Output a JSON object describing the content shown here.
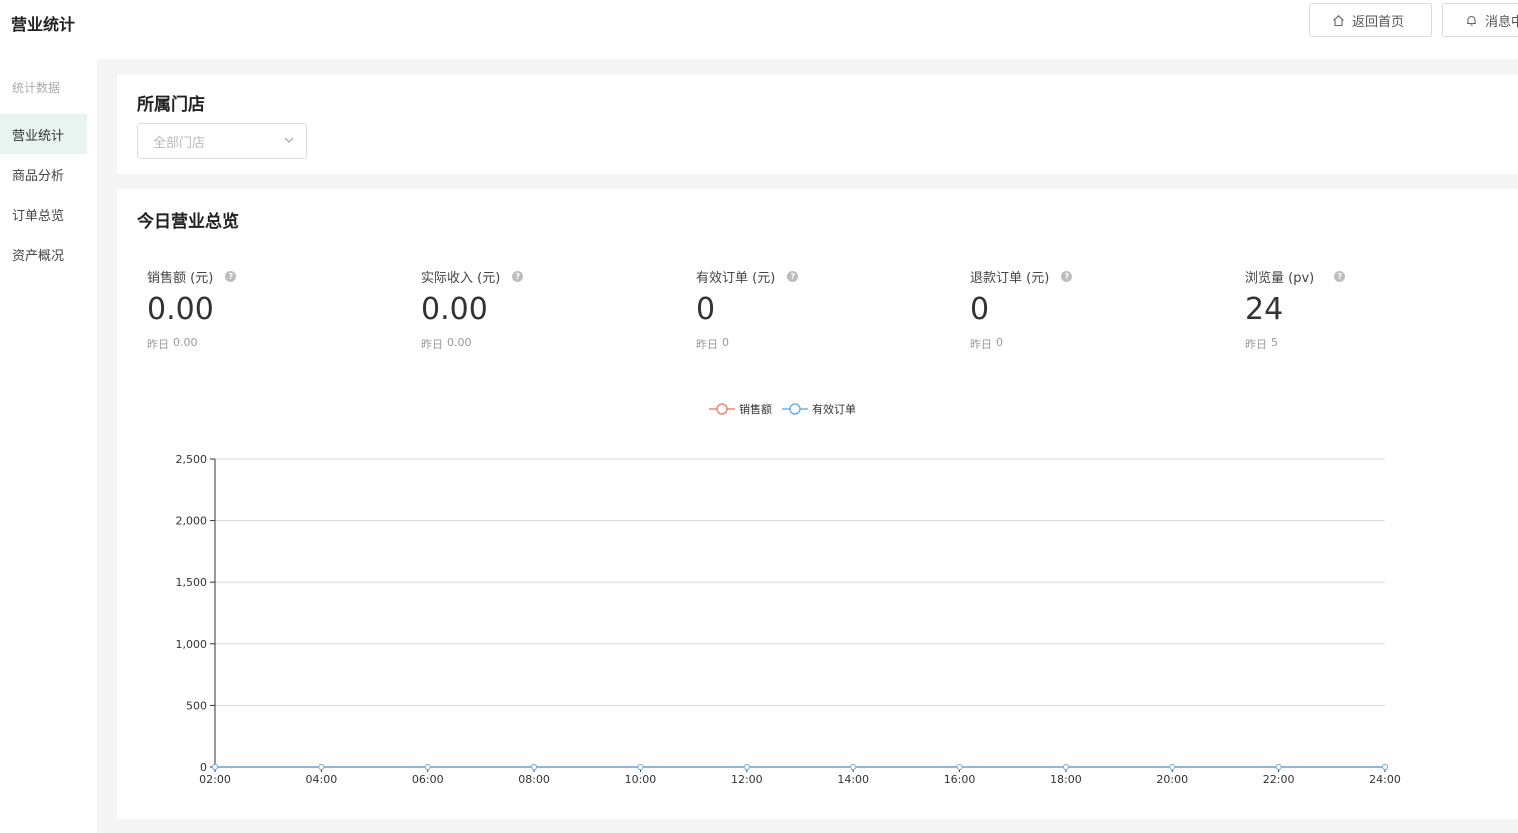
{
  "header": {
    "title": "营业统计",
    "home_label": "返回首页",
    "message_label": "消息中"
  },
  "sidebar": {
    "group_label": "统计数据",
    "items": [
      {
        "label": "营业统计",
        "active": true
      },
      {
        "label": "商品分析",
        "active": false
      },
      {
        "label": "订单总览",
        "active": false
      },
      {
        "label": "资产概况",
        "active": false
      }
    ]
  },
  "store_card": {
    "title": "所属门店",
    "select_placeholder": "全部门店"
  },
  "overview": {
    "title": "今日营业总览",
    "stats": [
      {
        "label": "销售额 (元)",
        "value": "0.00",
        "yesterday_label": "昨日",
        "yesterday_value": "0.00"
      },
      {
        "label": "实际收入 (元)",
        "value": "0.00",
        "yesterday_label": "昨日",
        "yesterday_value": "0.00"
      },
      {
        "label": "有效订单 (元)",
        "value": "0",
        "yesterday_label": "昨日",
        "yesterday_value": "0"
      },
      {
        "label": "退款订单 (元)",
        "value": "0",
        "yesterday_label": "昨日",
        "yesterday_value": "0"
      },
      {
        "label": "浏览量 (pv)",
        "value": "24",
        "yesterday_label": "昨日",
        "yesterday_value": "5"
      }
    ]
  },
  "colors": {
    "sales": "#ee8a6e",
    "orders": "#6fb2ea",
    "active_bg": "#e8f4f0"
  },
  "chart_data": {
    "type": "line",
    "x": [
      "02:00",
      "04:00",
      "06:00",
      "08:00",
      "10:00",
      "12:00",
      "14:00",
      "16:00",
      "18:00",
      "20:00",
      "22:00",
      "24:00"
    ],
    "series": [
      {
        "name": "销售额",
        "values": [
          0,
          0,
          0,
          0,
          0,
          0,
          0,
          0,
          0,
          0,
          0,
          0
        ]
      },
      {
        "name": "有效订单",
        "values": [
          0,
          0,
          0,
          0,
          0,
          0,
          0,
          0,
          0,
          0,
          0,
          0
        ]
      }
    ],
    "yticks": [
      "0",
      "500",
      "1,000",
      "1,500",
      "2,000",
      "2,500"
    ],
    "ylim": [
      0,
      2500
    ],
    "grid": true,
    "legend": "top-center"
  }
}
